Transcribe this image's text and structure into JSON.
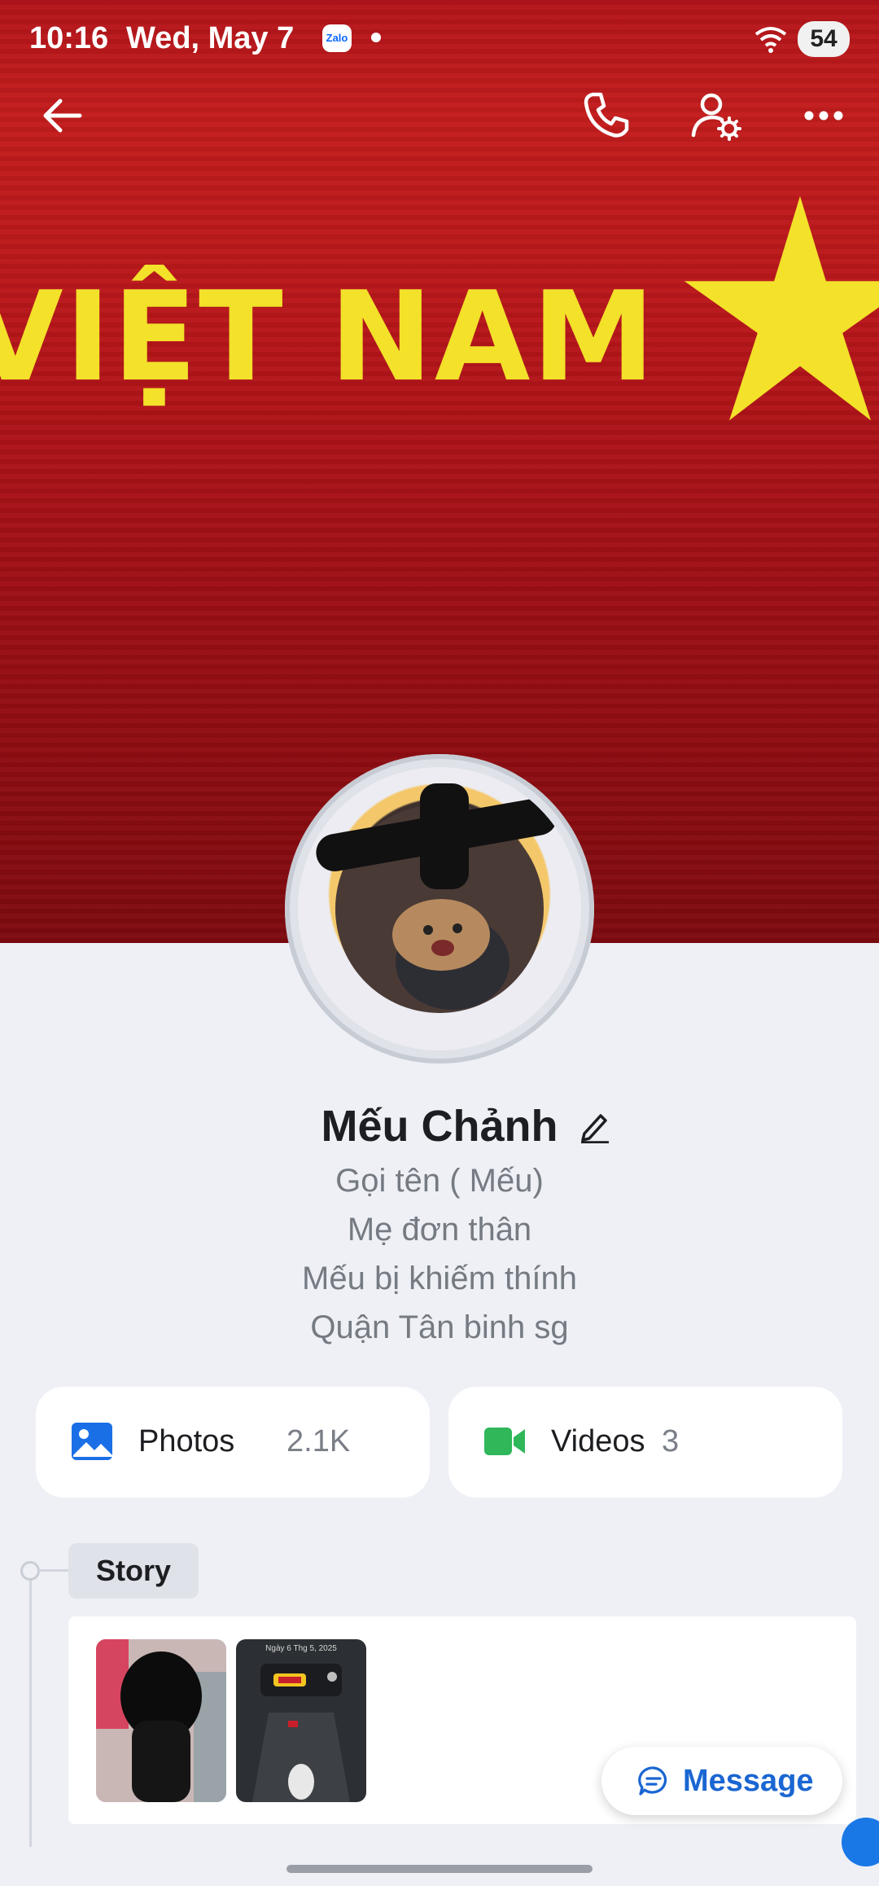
{
  "status": {
    "time": "10:16",
    "date": "Wed, May 7",
    "notification_app": "Zalo",
    "battery": "54"
  },
  "cover": {
    "banner_text": "VIỆT NAM",
    "colors": {
      "background": "#b3141a",
      "text": "#f3e12a"
    }
  },
  "toolbar": {
    "back_icon": "arrow-left-icon",
    "call_icon": "phone-icon",
    "settings_icon": "user-gear-icon",
    "more_icon": "more-dots-icon"
  },
  "profile": {
    "name": "Mếu Chảnh",
    "bio": [
      "Gọi tên ( Mếu)",
      "Mẹ đơn thân",
      "Mếu bị khiếm thính",
      "Quận Tân binh sg"
    ]
  },
  "media": {
    "photos": {
      "label": "Photos",
      "count": "2.1K",
      "icon": "image-icon",
      "color": "#1a6fe6"
    },
    "videos": {
      "label": "Videos",
      "count": "3",
      "icon": "video-camera-icon",
      "color": "#2fb75a"
    }
  },
  "story": {
    "label": "Story",
    "thumb2_caption": "Ngày 6 Thg 5, 2025"
  },
  "message_button": {
    "label": "Message",
    "icon": "chat-bubble-icon",
    "color": "#1a66d2"
  }
}
